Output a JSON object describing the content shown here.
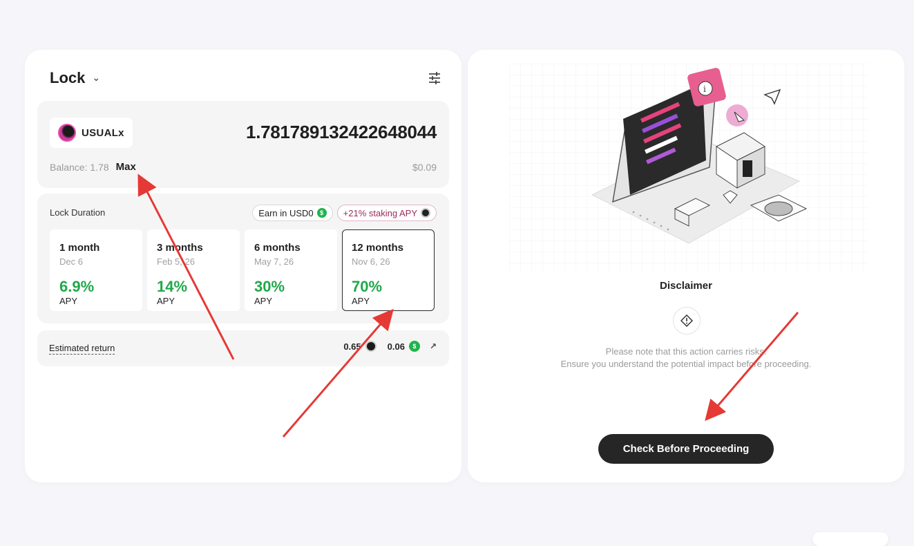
{
  "lock_card": {
    "title": "Lock",
    "token": {
      "name": "USUALx"
    },
    "amount": "1.781789132422648044",
    "balance_label": "Balance: 1.78",
    "max_label": "Max",
    "usd_value": "$0.09",
    "duration_label": "Lock Duration",
    "badges": {
      "earn": "Earn in USD0",
      "stake": "+21% staking APY"
    },
    "options": [
      {
        "months": "1 month",
        "date": "Dec 6",
        "apy": "6.9%",
        "apy_label": "APY"
      },
      {
        "months": "3 months",
        "date": "Feb 5, 26",
        "apy": "14%",
        "apy_label": "APY"
      },
      {
        "months": "6 months",
        "date": "May 7, 26",
        "apy": "30%",
        "apy_label": "APY"
      },
      {
        "months": "12 months",
        "date": "Nov 6, 26",
        "apy": "70%",
        "apy_label": "APY"
      }
    ],
    "selected_option": "12 months",
    "estimated_return_label": "Estimated return",
    "return_usualx": "0.65",
    "return_usd0": "0.06"
  },
  "disclaimer_card": {
    "title": "Disclaimer",
    "line1": "Please note that this action carries risks.",
    "line2": "Ensure you understand the potential impact before proceeding.",
    "cta": "Check Before Proceeding"
  },
  "colors": {
    "apy_green": "#1fa84a",
    "annotation_red": "#e53935",
    "cta_bg": "#262626",
    "stake_badge": "#9c2a5b"
  }
}
